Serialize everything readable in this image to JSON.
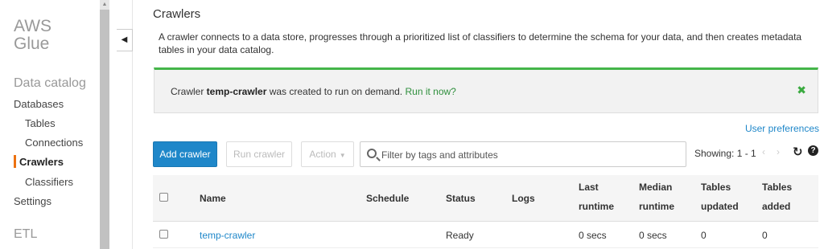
{
  "sidebar": {
    "brand_line1": "AWS",
    "brand_line2": "Glue",
    "data_catalog_title": "Data catalog",
    "items": {
      "databases": "Databases",
      "tables": "Tables",
      "connections": "Connections",
      "crawlers": "Crawlers",
      "classifiers": "Classifiers",
      "settings": "Settings"
    },
    "etl_title": "ETL",
    "active_item": "Crawlers"
  },
  "main": {
    "title": "Crawlers",
    "description": "A crawler connects to a data store, progresses through a prioritized list of classifiers to determine the schema for your data, and then creates metadata tables in your data catalog.",
    "flash": {
      "prefix": "Crawler ",
      "crawler_name": "temp-crawler",
      "suffix": " was created to run on demand. ",
      "link": "Run it now?",
      "close_glyph": "✖"
    },
    "user_preferences": "User preferences"
  },
  "toolbar": {
    "add_crawler": "Add crawler",
    "run_crawler": "Run crawler",
    "action": "Action",
    "action_caret": "▼",
    "search_placeholder": "Filter by tags and attributes",
    "showing": "Showing: 1 - 1",
    "prev_glyph": "‹",
    "next_glyph": "›",
    "refresh_glyph": "↻",
    "help_glyph": "?"
  },
  "table": {
    "headers": {
      "name": "Name",
      "schedule": "Schedule",
      "status": "Status",
      "logs": "Logs",
      "last_runtime_1": "Last",
      "last_runtime_2": "runtime",
      "median_runtime_1": "Median",
      "median_runtime_2": "runtime",
      "tables_updated_1": "Tables",
      "tables_updated_2": "updated",
      "tables_added_1": "Tables",
      "tables_added_2": "added"
    },
    "rows": [
      {
        "name": "temp-crawler",
        "schedule": "",
        "status": "Ready",
        "logs": "",
        "last_runtime": "0 secs",
        "median_runtime": "0 secs",
        "tables_updated": "0",
        "tables_added": "0"
      }
    ]
  },
  "colors": {
    "accent_blue": "#1f87c9",
    "success_green": "#44b549",
    "active_orange": "#ec7211"
  }
}
